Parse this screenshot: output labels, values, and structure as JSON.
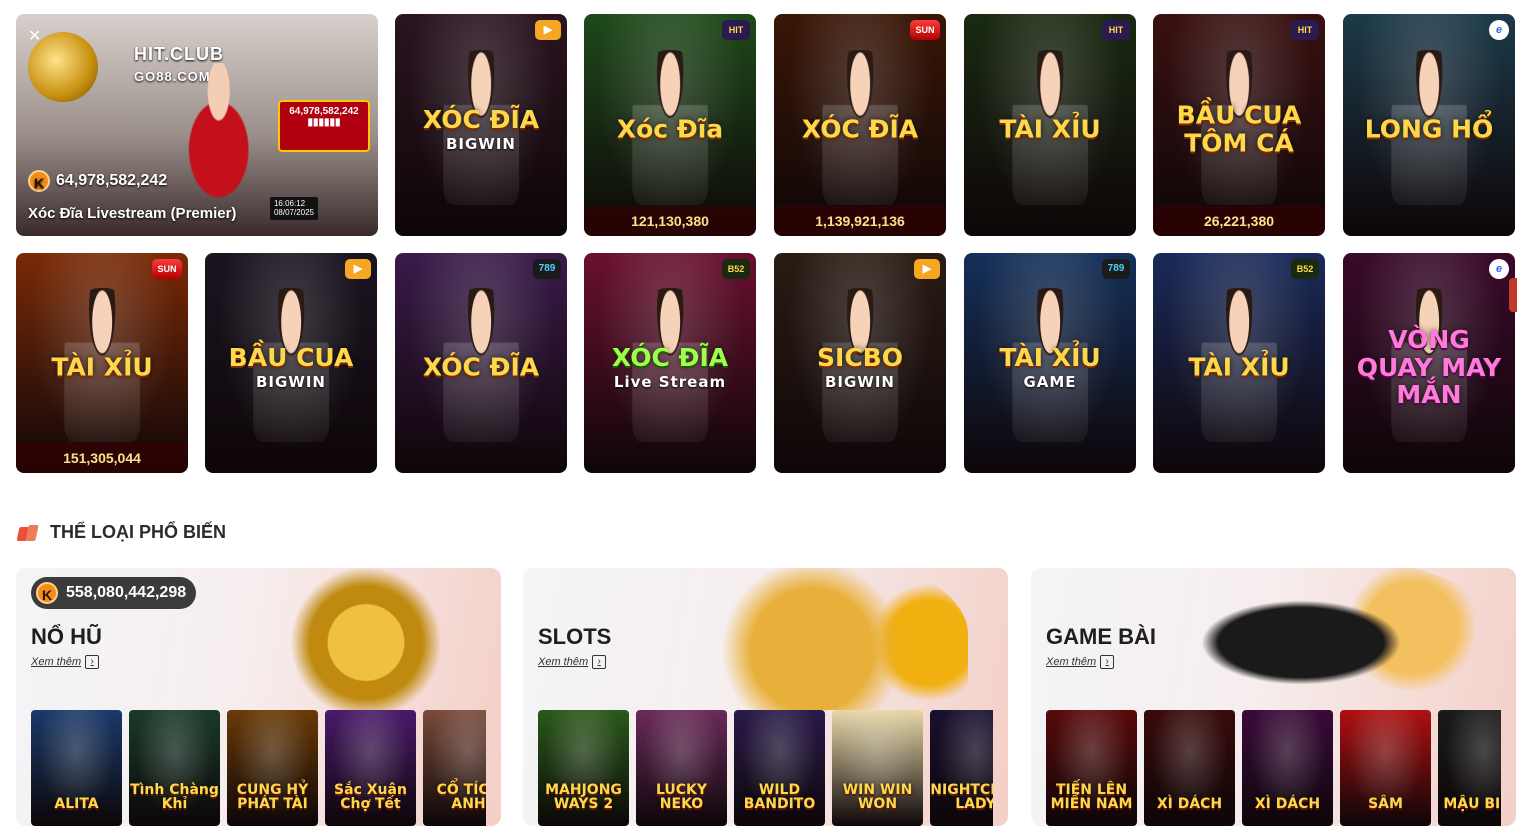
{
  "live": {
    "jackpot": "64,978,582,242",
    "title": "Xóc Đĩa Livestream (Premier)",
    "logo": "HIT.CLUB",
    "logo_sub": "GO88.COM",
    "board": "64,978,582,242",
    "clock_time": "16:06:12",
    "clock_date": "08/07/2025",
    "mute_icon": "speaker-mute-icon"
  },
  "row1": [
    {
      "title": "XÓC ĐĨA",
      "sub": "BIGWIN",
      "jackpot": "",
      "badge": "▶",
      "badge_kind": "play",
      "bg": "#2a1420"
    },
    {
      "title": "Xóc Đĩa",
      "sub": "",
      "jackpot": "121,130,380",
      "badge": "HIT",
      "badge_kind": "hit",
      "bg": "#1e4a1a"
    },
    {
      "title": "XÓC ĐĨA",
      "sub": "",
      "jackpot": "1,139,921,136",
      "badge": "SUN",
      "badge_kind": "sun",
      "bg": "#3a1606"
    },
    {
      "title": "TÀI XỈU",
      "sub": "",
      "jackpot": "",
      "badge": "HIT",
      "badge_kind": "hit",
      "bg": "#1a2a12"
    },
    {
      "title": "BẦU CUA TÔM CÁ",
      "sub": "",
      "jackpot": "26,221,380",
      "badge": "HIT",
      "badge_kind": "hit",
      "bg": "#3a1010"
    },
    {
      "title": "LONG HỔ",
      "sub": "",
      "jackpot": "",
      "badge": "e",
      "badge_kind": "e",
      "bg": "#1c3a4a"
    }
  ],
  "row2": [
    {
      "title": "TÀI XỈU",
      "sub": "",
      "jackpot": "151,305,044",
      "badge": "SUN",
      "badge_kind": "sun",
      "bg": "#7a2a06"
    },
    {
      "title": "BẦU CUA",
      "sub": "BIGWIN",
      "jackpot": "",
      "badge": "▶",
      "badge_kind": "play",
      "bg": "#1a1420"
    },
    {
      "title": "XÓC ĐĨA",
      "sub": "",
      "jackpot": "",
      "badge": "789",
      "badge_kind": "n789",
      "bg": "#3a1a4a"
    },
    {
      "title": "XÓC ĐĨA",
      "sub": "Live Stream",
      "jackpot": "",
      "badge": "B52",
      "badge_kind": "b52",
      "bg": "#6a1030"
    },
    {
      "title": "SICBO",
      "sub": "BIGWIN",
      "jackpot": "",
      "badge": "▶",
      "badge_kind": "play",
      "bg": "#2a1c14"
    },
    {
      "title": "TÀI XỈU",
      "sub": "GAME",
      "jackpot": "",
      "badge": "789",
      "badge_kind": "n789",
      "bg": "#14305a"
    },
    {
      "title": "TÀI XỈU",
      "sub": "",
      "jackpot": "",
      "badge": "B52",
      "badge_kind": "b52",
      "bg": "#1a2a5a"
    },
    {
      "title": "VÒNG QUAY MAY MẮN",
      "sub": "",
      "jackpot": "",
      "badge": "e",
      "badge_kind": "e",
      "bg": "#3a0a2a"
    }
  ],
  "section": {
    "title": "THỂ LOẠI PHỔ BIẾN"
  },
  "categories": [
    {
      "name": "NỔ HŨ",
      "more": "Xem thêm",
      "jackpot": "558,080,442,298",
      "games": [
        {
          "title": "ALITA",
          "bg": "#1a3a6a"
        },
        {
          "title": "Tình Chàng Khỉ",
          "bg": "#1a3a2a"
        },
        {
          "title": "CUNG HỶ PHÁT TÀI",
          "bg": "#6a3a06"
        },
        {
          "title": "Sắc Xuân Chợ Tết",
          "bg": "#4a1a6a"
        },
        {
          "title": "CỔ TÍCH ANH",
          "bg": "#7a4a3a"
        }
      ]
    },
    {
      "name": "SLOTS",
      "more": "Xem thêm",
      "jackpot": "",
      "games": [
        {
          "title": "MAHJONG WAYS 2",
          "bg": "#2a5a1a"
        },
        {
          "title": "LUCKY NEKO",
          "bg": "#6a2a5a"
        },
        {
          "title": "WILD BANDITO",
          "bg": "#2a1a4a"
        },
        {
          "title": "WIN WIN WON",
          "bg": "#e8d8a8"
        },
        {
          "title": "NIGHTCLUB LADY",
          "bg": "#1a1030"
        }
      ]
    },
    {
      "name": "GAME BÀI",
      "more": "Xem thêm",
      "jackpot": "",
      "games": [
        {
          "title": "TIẾN LÊN MIỀN NAM",
          "bg": "#5a0a0a"
        },
        {
          "title": "XÌ DÁCH",
          "bg": "#3a0a0a"
        },
        {
          "title": "XÌ DÁCH",
          "bg": "#3a0a3a"
        },
        {
          "title": "SÂM",
          "bg": "#b01010"
        },
        {
          "title": "MẬU BINH",
          "bg": "#1a1a1a"
        }
      ]
    }
  ],
  "colors": {
    "accent": "#e8503a",
    "jackpot_text": "#ffe08a",
    "k_icon": "#f28c1a"
  }
}
